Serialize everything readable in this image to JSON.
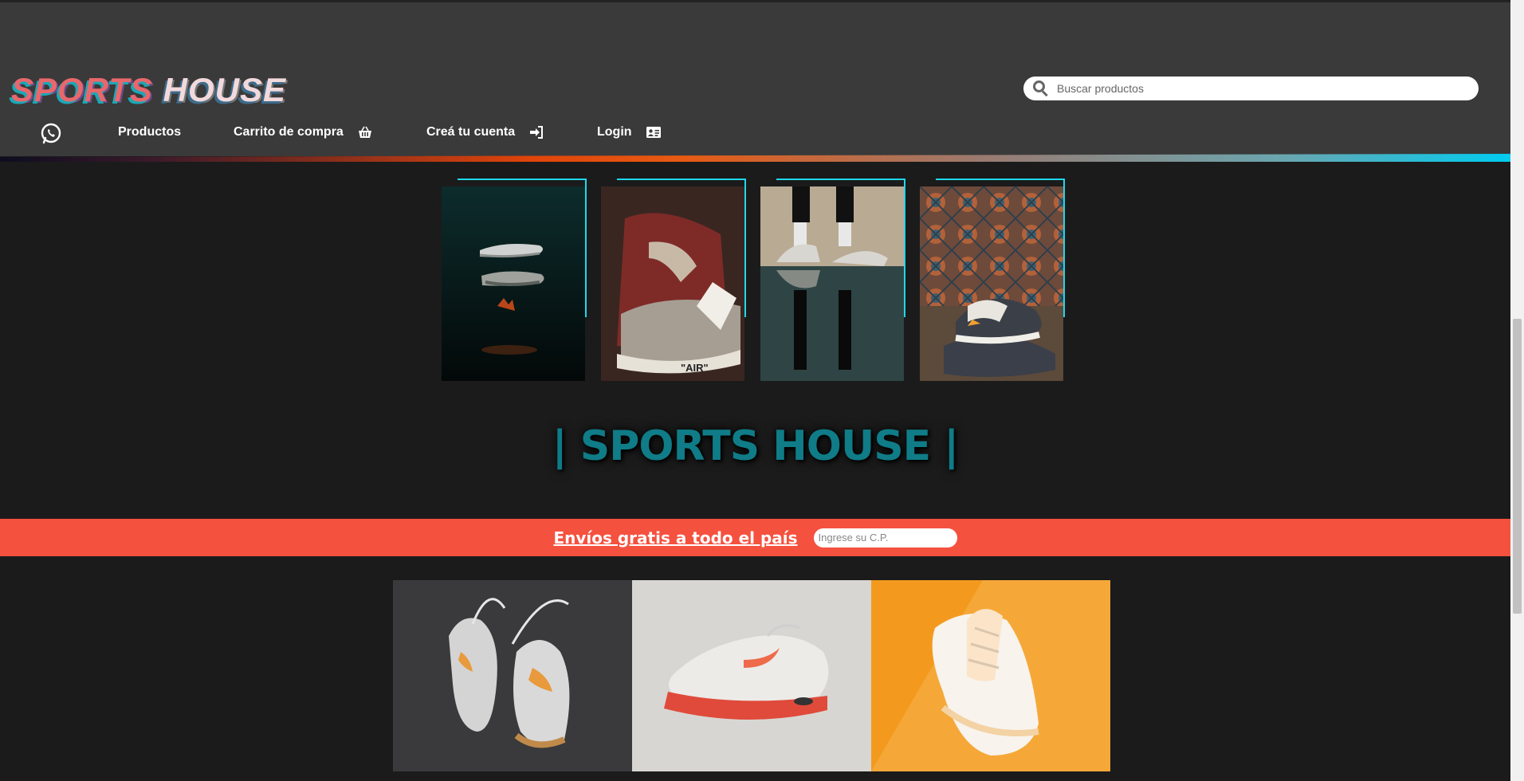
{
  "header": {
    "logo_word1": "SPORTS",
    "logo_word2": "HOUSE",
    "search_placeholder": "Buscar productos"
  },
  "nav": {
    "items": [
      {
        "label": "Productos"
      },
      {
        "label": "Carrito de compra"
      },
      {
        "label": "Creá tu cuenta"
      },
      {
        "label": "Login"
      }
    ]
  },
  "gallery": {
    "images": [
      {
        "alt": "floating sneakers dark"
      },
      {
        "alt": "red high-top AIR sneaker"
      },
      {
        "alt": "person standing in sneakers on reflective floor"
      },
      {
        "alt": "sneaker on cushion with tiled background"
      }
    ]
  },
  "main": {
    "title": "| SPORTS HOUSE |"
  },
  "banner": {
    "text": "Envíos gratis a todo el país",
    "postal_placeholder": "Ingrese su C.P."
  },
  "products": {
    "tiles": [
      {
        "alt": "grey high-top sneakers with orange swoosh"
      },
      {
        "alt": "white and orange running shoe"
      },
      {
        "alt": "white sneaker on orange background"
      }
    ]
  },
  "colors": {
    "header_bg": "#3a3a3a",
    "page_bg": "#1b1b1b",
    "accent_cyan": "#20d8ea",
    "banner_red": "#f5513f",
    "title_teal": "#0f7c87"
  }
}
